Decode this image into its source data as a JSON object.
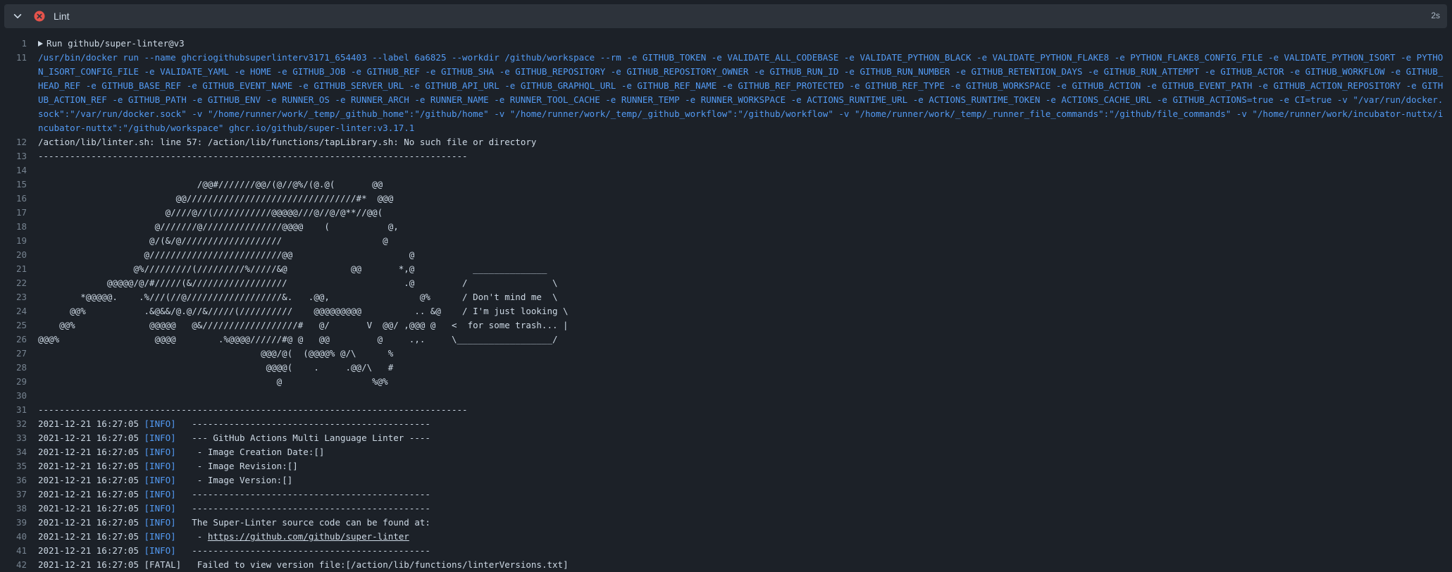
{
  "step": {
    "title": "Lint",
    "duration": "2s",
    "status_icon": "x-circle-fill-icon",
    "status_color": "#e5534b"
  },
  "log": [
    {
      "n": "1",
      "type": "group",
      "text": "Run github/super-linter@v3"
    },
    {
      "n": "11",
      "type": "cmd",
      "text": "/usr/bin/docker run --name ghcriogithubsuperlinterv3171_654403 --label 6a6825 --workdir /github/workspace --rm -e GITHUB_TOKEN -e VALIDATE_ALL_CODEBASE -e VALIDATE_PYTHON_BLACK -e VALIDATE_PYTHON_FLAKE8 -e PYTHON_FLAKE8_CONFIG_FILE -e VALIDATE_PYTHON_ISORT -e PYTHON_ISORT_CONFIG_FILE -e VALIDATE_YAML -e HOME -e GITHUB_JOB -e GITHUB_REF -e GITHUB_SHA -e GITHUB_REPOSITORY -e GITHUB_REPOSITORY_OWNER -e GITHUB_RUN_ID -e GITHUB_RUN_NUMBER -e GITHUB_RETENTION_DAYS -e GITHUB_RUN_ATTEMPT -e GITHUB_ACTOR -e GITHUB_WORKFLOW -e GITHUB_HEAD_REF -e GITHUB_BASE_REF -e GITHUB_EVENT_NAME -e GITHUB_SERVER_URL -e GITHUB_API_URL -e GITHUB_GRAPHQL_URL -e GITHUB_REF_NAME -e GITHUB_REF_PROTECTED -e GITHUB_REF_TYPE -e GITHUB_WORKSPACE -e GITHUB_ACTION -e GITHUB_EVENT_PATH -e GITHUB_ACTION_REPOSITORY -e GITHUB_ACTION_REF -e GITHUB_PATH -e GITHUB_ENV -e RUNNER_OS -e RUNNER_ARCH -e RUNNER_NAME -e RUNNER_TOOL_CACHE -e RUNNER_TEMP -e RUNNER_WORKSPACE -e ACTIONS_RUNTIME_URL -e ACTIONS_RUNTIME_TOKEN -e ACTIONS_CACHE_URL -e GITHUB_ACTIONS=true -e CI=true -v \"/var/run/docker.sock\":\"/var/run/docker.sock\" -v \"/home/runner/work/_temp/_github_home\":\"/github/home\" -v \"/home/runner/work/_temp/_github_workflow\":\"/github/workflow\" -v \"/home/runner/work/_temp/_runner_file_commands\":\"/github/file_commands\" -v \"/home/runner/work/incubator-nuttx/incubator-nuttx\":\"/github/workspace\" ghcr.io/github/super-linter:v3.17.1"
    },
    {
      "n": "12",
      "type": "plain",
      "text": "/action/lib/linter.sh: line 57: /action/lib/functions/tapLibrary.sh: No such file or directory"
    },
    {
      "n": "13",
      "type": "plain",
      "text": "---------------------------------------------------------------------------------"
    },
    {
      "n": "14",
      "type": "plain",
      "text": ""
    },
    {
      "n": "15",
      "type": "plain",
      "text": "                              /@@#///////@@/(@//@%/(@.@(       @@"
    },
    {
      "n": "16",
      "type": "plain",
      "text": "                          @@////////////////////////////////#*  @@@"
    },
    {
      "n": "17",
      "type": "plain",
      "text": "                        @////@//(///////////@@@@@///@//@/@**//@@("
    },
    {
      "n": "18",
      "type": "plain",
      "text": "                      @///////@///////////////@@@@    (           @,"
    },
    {
      "n": "19",
      "type": "plain",
      "text": "                     @/(&/@///////////////////                   @"
    },
    {
      "n": "20",
      "type": "plain",
      "text": "                    @/////////////////////////@@                      @"
    },
    {
      "n": "21",
      "type": "plain",
      "text": "                  @%/////////(/////////%/////&@            @@       *,@           ______________"
    },
    {
      "n": "22",
      "type": "plain",
      "text": "             @@@@@/@/#/////(&//////////////////                      .@         /                \\"
    },
    {
      "n": "23",
      "type": "plain",
      "text": "        *@@@@@.    .%///(//@//////////////////&.   .@@,                 @%      / Don't mind me  \\"
    },
    {
      "n": "24",
      "type": "plain",
      "text": "      @@%           .&@&&/@.@//&/////(//////////    @@@@@@@@@          .. &@    / I'm just looking \\"
    },
    {
      "n": "25",
      "type": "plain",
      "text": "    @@%              @@@@@   @&//////////////////#   @/       V  @@/ ,@@@ @   <  for some trash... |"
    },
    {
      "n": "26",
      "type": "plain",
      "text": "@@@%                  @@@@        .%@@@@//////#@ @   @@         @     .,.     \\__________________/"
    },
    {
      "n": "27",
      "type": "plain",
      "text": "                                          @@@/@(  (@@@@% @/\\      %"
    },
    {
      "n": "28",
      "type": "plain",
      "text": "                                           @@@@(    .     .@@/\\   #"
    },
    {
      "n": "29",
      "type": "plain",
      "text": "                                             @                 %@%"
    },
    {
      "n": "30",
      "type": "plain",
      "text": ""
    },
    {
      "n": "31",
      "type": "plain",
      "text": "---------------------------------------------------------------------------------"
    },
    {
      "n": "32",
      "type": "info",
      "ts": "2021-12-21 16:27:05",
      "level": "[INFO]",
      "text": "   ---------------------------------------------"
    },
    {
      "n": "33",
      "type": "info",
      "ts": "2021-12-21 16:27:05",
      "level": "[INFO]",
      "text": "   --- GitHub Actions Multi Language Linter ----"
    },
    {
      "n": "34",
      "type": "info",
      "ts": "2021-12-21 16:27:05",
      "level": "[INFO]",
      "text": "    - Image Creation Date:[]"
    },
    {
      "n": "35",
      "type": "info",
      "ts": "2021-12-21 16:27:05",
      "level": "[INFO]",
      "text": "    - Image Revision:[]"
    },
    {
      "n": "36",
      "type": "info",
      "ts": "2021-12-21 16:27:05",
      "level": "[INFO]",
      "text": "    - Image Version:[]"
    },
    {
      "n": "37",
      "type": "info",
      "ts": "2021-12-21 16:27:05",
      "level": "[INFO]",
      "text": "   ---------------------------------------------"
    },
    {
      "n": "38",
      "type": "info",
      "ts": "2021-12-21 16:27:05",
      "level": "[INFO]",
      "text": "   ---------------------------------------------"
    },
    {
      "n": "39",
      "type": "info",
      "ts": "2021-12-21 16:27:05",
      "level": "[INFO]",
      "text": "   The Super-Linter source code can be found at:"
    },
    {
      "n": "40",
      "type": "link",
      "ts": "2021-12-21 16:27:05",
      "level": "[INFO]",
      "text": "    - ",
      "link": "https://github.com/github/super-linter"
    },
    {
      "n": "41",
      "type": "info",
      "ts": "2021-12-21 16:27:05",
      "level": "[INFO]",
      "text": "   ---------------------------------------------"
    },
    {
      "n": "42",
      "type": "fatal",
      "ts": "2021-12-21 16:27:05",
      "level": "[FATAL]",
      "text": "   Failed to view version file:[/action/lib/functions/linterVersions.txt]"
    }
  ]
}
